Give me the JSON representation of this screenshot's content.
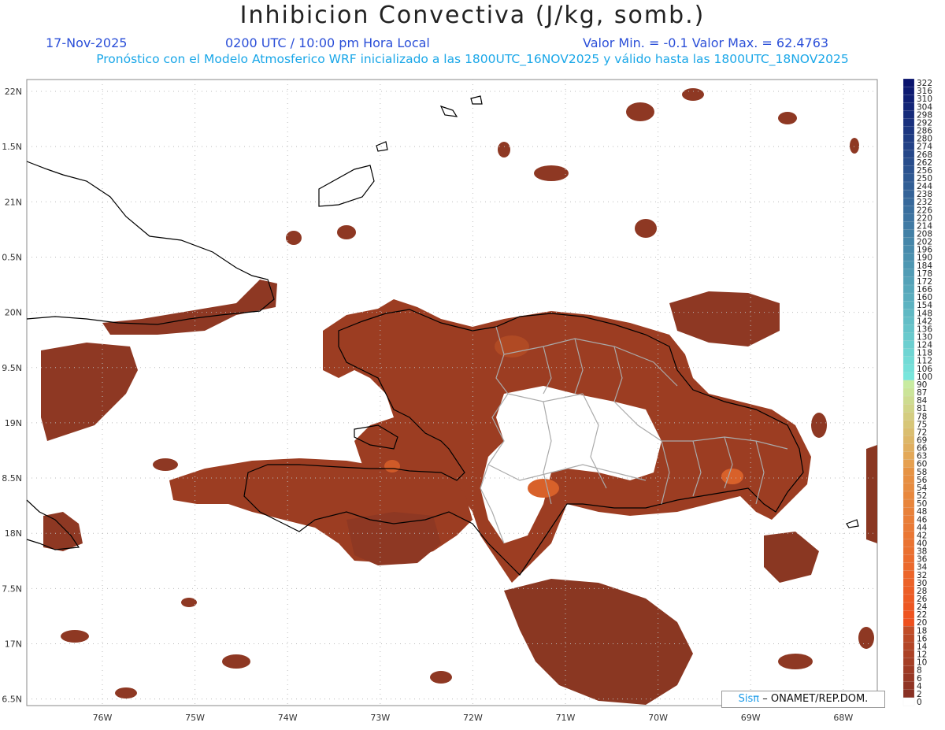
{
  "header": {
    "title": "Inhibicion Convectiva (J/kg, somb.)",
    "date": "17-Nov-2025",
    "time": "0200 UTC / 10:00 pm Hora Local",
    "minmax": "Valor Min. = -0.1  Valor Max. = 62.4763",
    "description": "Pronóstico con el Modelo Atmosferico WRF inicializado a las 1800UTC_16NOV2025 y válido hasta las  1800UTC_18NOV2025"
  },
  "axes": {
    "lat_labels": [
      "22N",
      "1.5N",
      "21N",
      "0.5N",
      "20N",
      "9.5N",
      "19N",
      "8.5N",
      "18N",
      "7.5N",
      "17N",
      "6.5N"
    ],
    "lon_labels": [
      "76W",
      "75W",
      "74W",
      "73W",
      "72W",
      "71W",
      "70W",
      "69W",
      "68W"
    ],
    "lat_values": [
      22,
      21.5,
      21,
      20.5,
      20,
      19.5,
      19,
      18.5,
      18,
      17.5,
      17,
      16.5
    ],
    "lon_values": [
      -76,
      -75,
      -74,
      -73,
      -72,
      -71,
      -70,
      -69,
      -68
    ]
  },
  "colorbar": {
    "labels": [
      "322",
      "316",
      "310",
      "304",
      "298",
      "292",
      "286",
      "280",
      "274",
      "268",
      "262",
      "256",
      "250",
      "244",
      "238",
      "232",
      "226",
      "220",
      "214",
      "208",
      "202",
      "196",
      "190",
      "184",
      "178",
      "172",
      "166",
      "160",
      "154",
      "148",
      "142",
      "136",
      "130",
      "124",
      "118",
      "112",
      "106",
      "100",
      "90",
      "87",
      "84",
      "81",
      "78",
      "75",
      "72",
      "69",
      "66",
      "63",
      "60",
      "58",
      "56",
      "54",
      "52",
      "50",
      "48",
      "46",
      "44",
      "42",
      "40",
      "38",
      "36",
      "34",
      "32",
      "30",
      "28",
      "26",
      "24",
      "22",
      "20",
      "18",
      "16",
      "14",
      "12",
      "10",
      "8",
      "6",
      "4",
      "2",
      "0"
    ]
  },
  "colors": {
    "shade_dark": "#8a3a22",
    "shade_mid": "#a8431f",
    "shade_hot": "#e06a24",
    "coast": "#000000",
    "borders": "#aaaaaa",
    "grid": "#bbbbbb"
  },
  "credit": {
    "brand": "Sisπ",
    "text": "– ONAMET/REP.DOM."
  }
}
